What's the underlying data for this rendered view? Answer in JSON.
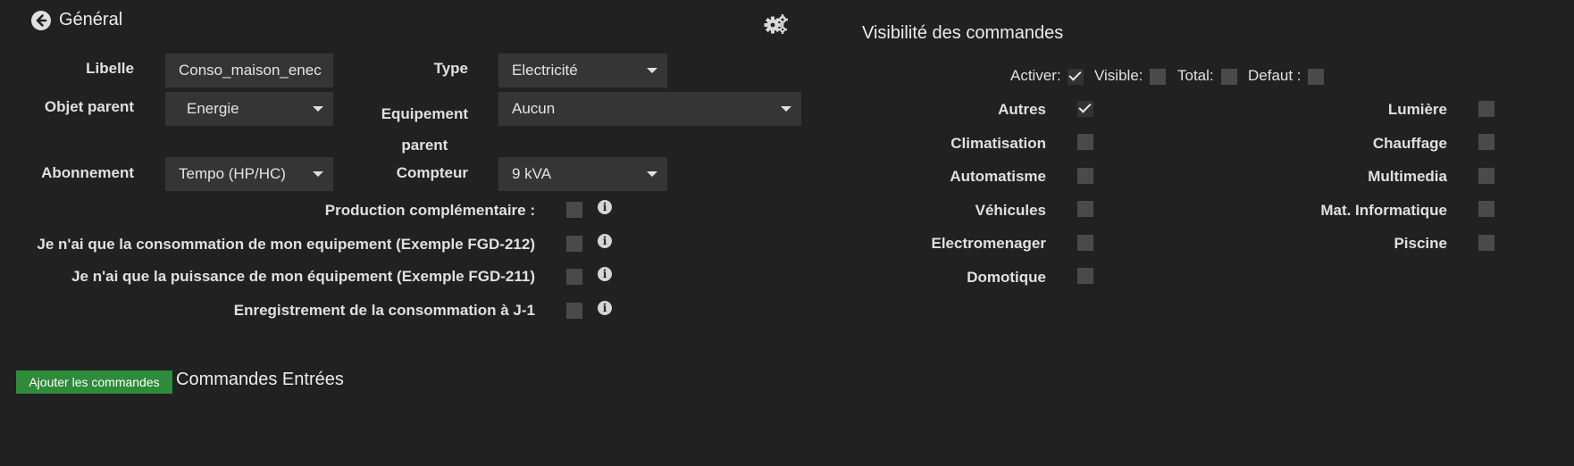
{
  "header": {
    "title": "Général",
    "back_icon": "arrow-circle-left-icon",
    "settings_icon": "gears-icon"
  },
  "general": {
    "libelle": {
      "label": "Libelle",
      "value": "Conso_maison_enec"
    },
    "type": {
      "label": "Type",
      "value": "Electricité"
    },
    "objet_parent": {
      "label": "Objet parent",
      "value": "Energie"
    },
    "equipement_parent": {
      "label_line1": "Equipement",
      "label_line2": "parent",
      "value": "Aucun"
    },
    "abonnement": {
      "label": "Abonnement",
      "value": "Tempo (HP/HC)"
    },
    "compteur": {
      "label": "Compteur",
      "value": "9 kVA"
    },
    "options": [
      {
        "label": "Production complémentaire :",
        "checked": false
      },
      {
        "label": "Je n'ai que la consommation de mon equipement (Exemple FGD-212)",
        "checked": false
      },
      {
        "label": "Je n'ai que la puissance de mon équipement (Exemple FGD-211)",
        "checked": false
      },
      {
        "label": "Enregistrement de la consommation à J-1",
        "checked": false
      }
    ]
  },
  "visibility": {
    "title": "Visibilité des commandes",
    "toggles": [
      {
        "label": "Activer:",
        "checked": true
      },
      {
        "label": "Visible:",
        "checked": false
      },
      {
        "label": "Total:",
        "checked": false
      },
      {
        "label": "Defaut :",
        "checked": false
      }
    ],
    "left_categories": [
      {
        "label": "Autres",
        "checked": true
      },
      {
        "label": "Climatisation",
        "checked": false
      },
      {
        "label": "Automatisme",
        "checked": false
      },
      {
        "label": "Véhicules",
        "checked": false
      },
      {
        "label": "Electromenager",
        "checked": false
      },
      {
        "label": "Domotique",
        "checked": false
      }
    ],
    "right_categories": [
      {
        "label": "Lumière",
        "checked": false
      },
      {
        "label": "Chauffage",
        "checked": false
      },
      {
        "label": "Multimedia",
        "checked": false
      },
      {
        "label": "Mat. Informatique",
        "checked": false
      },
      {
        "label": "Piscine",
        "checked": false
      }
    ]
  },
  "commands": {
    "add_button": "Ajouter les commandes",
    "section_title": "Commandes Entrées"
  },
  "colors": {
    "background": "#212121",
    "field": "#353535",
    "checkbox": "#4a4a4a",
    "button_green": "#2e8b3a"
  }
}
